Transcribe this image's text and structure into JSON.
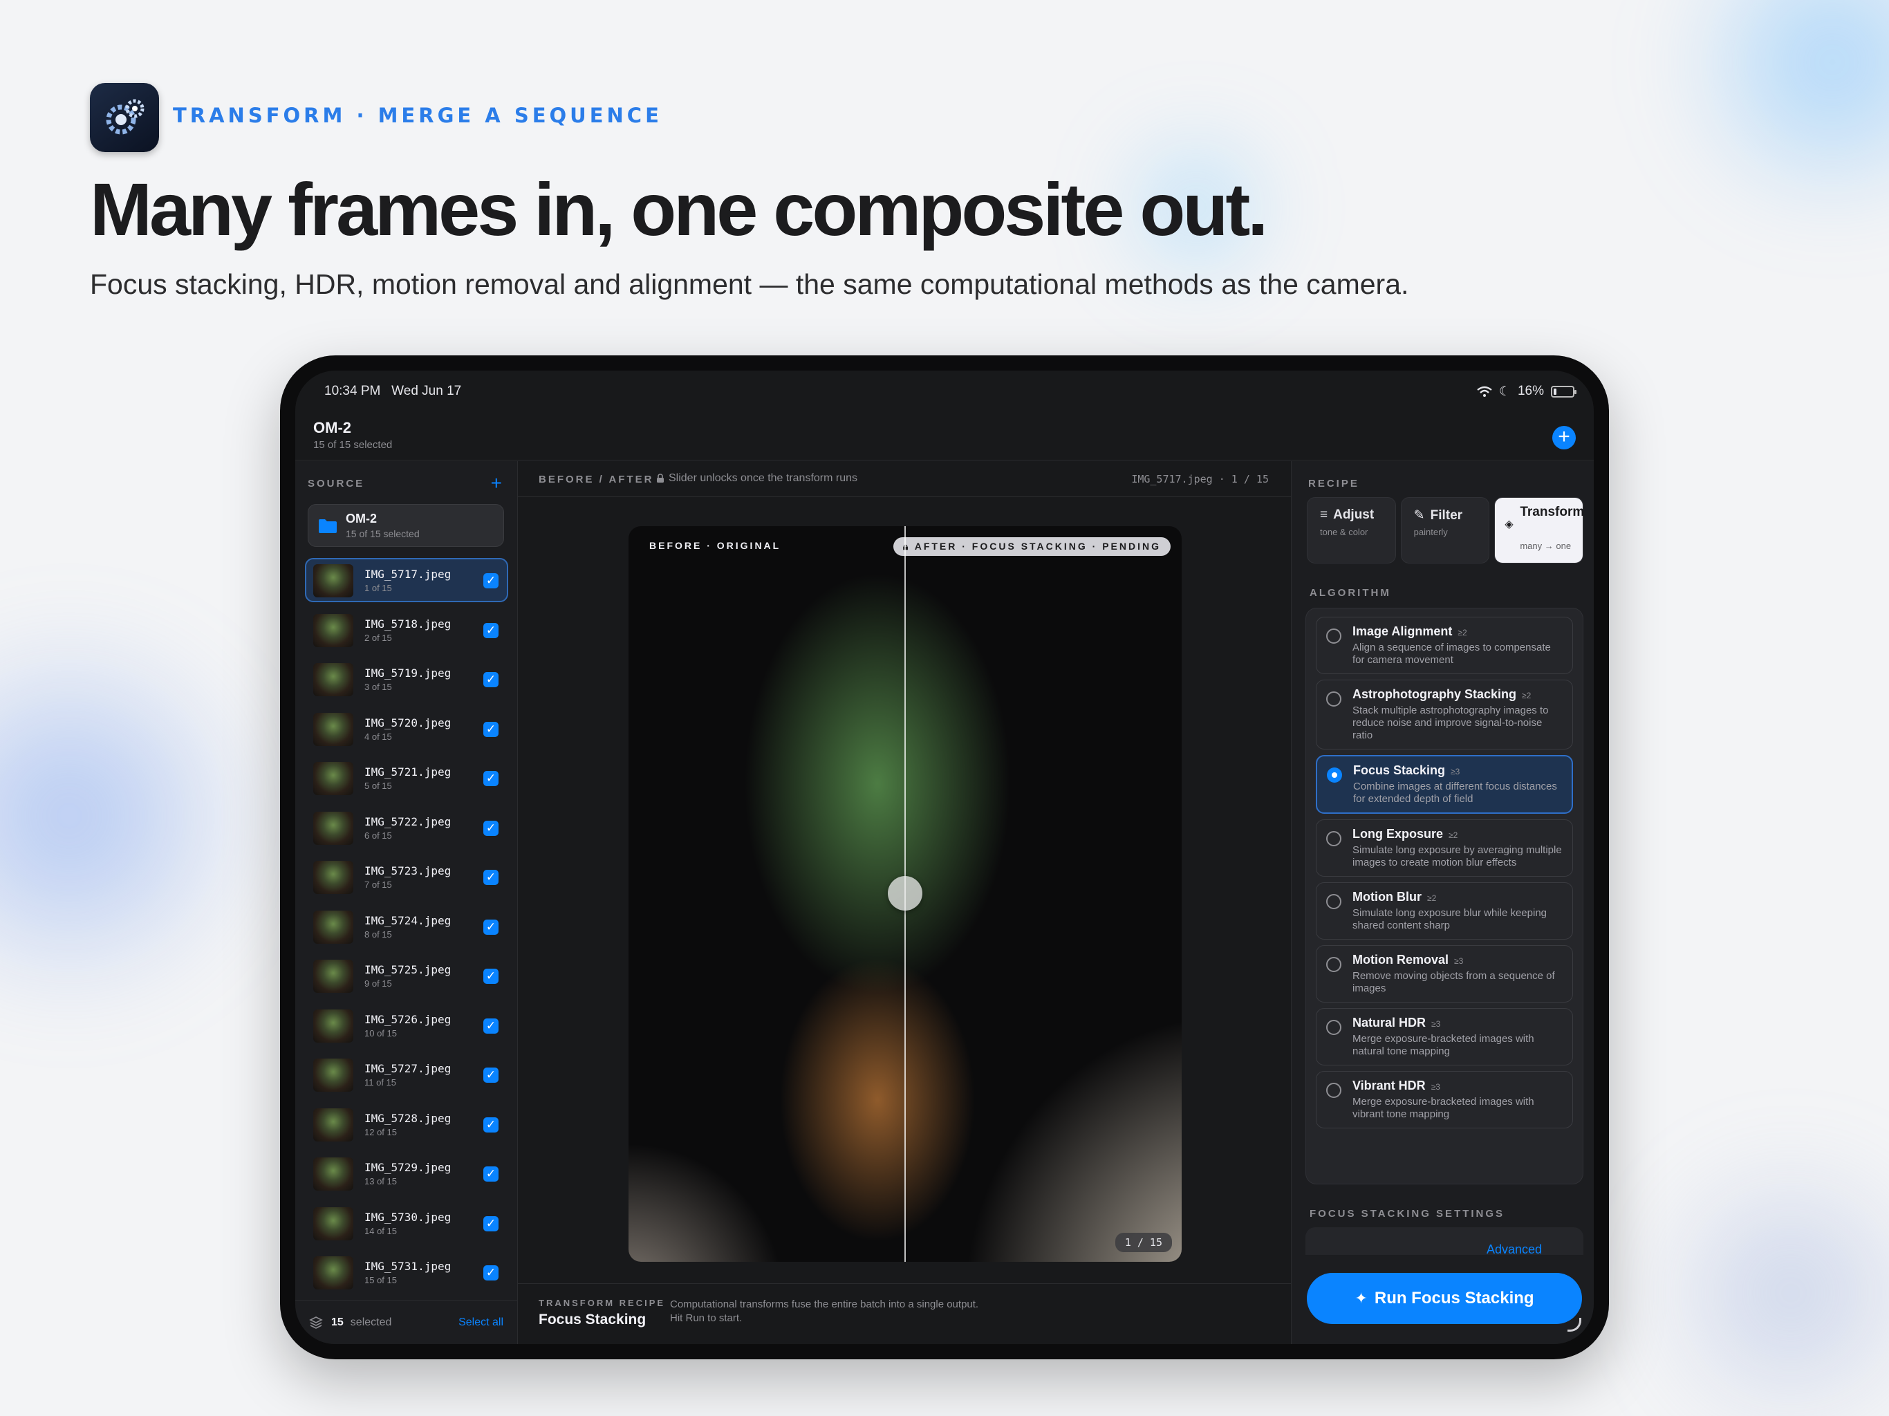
{
  "hero": {
    "eyebrow": "TRANSFORM · MERGE A SEQUENCE",
    "headline": "Many frames in, one composite out.",
    "subhead": "Focus stacking, HDR, motion removal and alignment — the same computational methods as the camera."
  },
  "status_bar": {
    "time": "10:34 PM",
    "date": "Wed Jun 17",
    "battery": "16%",
    "battery_level": 0.16
  },
  "nav": {
    "title": "OM-2",
    "subtitle": "15 of 15 selected",
    "add_icon": "plus-icon"
  },
  "sidebar": {
    "section_label": "SOURCE",
    "source": {
      "name": "OM-2",
      "subtitle": "15 of 15 selected"
    },
    "files": [
      {
        "name": "IMG_5717.jpeg",
        "position": "1 of 15",
        "selected": true
      },
      {
        "name": "IMG_5718.jpeg",
        "position": "2 of 15"
      },
      {
        "name": "IMG_5719.jpeg",
        "position": "3 of 15"
      },
      {
        "name": "IMG_5720.jpeg",
        "position": "4 of 15"
      },
      {
        "name": "IMG_5721.jpeg",
        "position": "5 of 15"
      },
      {
        "name": "IMG_5722.jpeg",
        "position": "6 of 15"
      },
      {
        "name": "IMG_5723.jpeg",
        "position": "7 of 15"
      },
      {
        "name": "IMG_5724.jpeg",
        "position": "8 of 15"
      },
      {
        "name": "IMG_5725.jpeg",
        "position": "9 of 15"
      },
      {
        "name": "IMG_5726.jpeg",
        "position": "10 of 15"
      },
      {
        "name": "IMG_5727.jpeg",
        "position": "11 of 15"
      },
      {
        "name": "IMG_5728.jpeg",
        "position": "12 of 15"
      },
      {
        "name": "IMG_5729.jpeg",
        "position": "13 of 15"
      },
      {
        "name": "IMG_5730.jpeg",
        "position": "14 of 15"
      },
      {
        "name": "IMG_5731.jpeg",
        "position": "15 of 15"
      }
    ],
    "footer": {
      "count": "15",
      "count_label": "selected",
      "select_all": "Select all"
    }
  },
  "main": {
    "header_label": "BEFORE / AFTER",
    "lock_note": "Slider unlocks once the transform runs",
    "file_indicator": "IMG_5717.jpeg · 1 / 15",
    "viewer": {
      "before_label": "BEFORE · ORIGINAL",
      "after_label": "AFTER · FOCUS STACKING · PENDING",
      "page": "1 / 15"
    },
    "footer": {
      "recipe_label": "TRANSFORM RECIPE",
      "recipe_name": "Focus Stacking",
      "description": "Computational transforms fuse the entire batch into a single output. Hit Run to start."
    }
  },
  "panel": {
    "recipe_label": "RECIPE",
    "tabs": [
      {
        "title": "Adjust",
        "subtitle": "tone & color",
        "icon": "sliders-icon"
      },
      {
        "title": "Filter",
        "subtitle": "painterly",
        "icon": "brush-icon"
      },
      {
        "title": "Transform",
        "subtitle": "many → one",
        "icon": "layers-icon",
        "active": true
      }
    ],
    "algorithm_label": "ALGORITHM",
    "algorithms": [
      {
        "name": "Image Alignment",
        "min": "≥2",
        "desc": "Align a sequence of images to compensate for camera movement"
      },
      {
        "name": "Astrophotography Stacking",
        "min": "≥2",
        "desc": "Stack multiple astrophotography images to reduce noise and improve signal-to-noise ratio"
      },
      {
        "name": "Focus Stacking",
        "min": "≥3",
        "desc": "Combine images at different focus distances for extended depth of field",
        "selected": true
      },
      {
        "name": "Long Exposure",
        "min": "≥2",
        "desc": "Simulate long exposure by averaging multiple images to create motion blur effects"
      },
      {
        "name": "Motion Blur",
        "min": "≥2",
        "desc": "Simulate long exposure blur while keeping shared content sharp"
      },
      {
        "name": "Motion Removal",
        "min": "≥3",
        "desc": "Remove moving objects from a sequence of images"
      },
      {
        "name": "Natural HDR",
        "min": "≥3",
        "desc": "Merge exposure-bracketed images with natural tone mapping"
      },
      {
        "name": "Vibrant HDR",
        "min": "≥3",
        "desc": "Merge exposure-bracketed images with vibrant tone mapping"
      }
    ],
    "settings_label": "FOCUS STACKING SETTINGS",
    "advanced": "Advanced",
    "run_button": "Run Focus Stacking"
  },
  "colors": {
    "accent": "#0a84ff",
    "eyebrow": "#2b7de9",
    "selected_bg": "#1e3350"
  }
}
